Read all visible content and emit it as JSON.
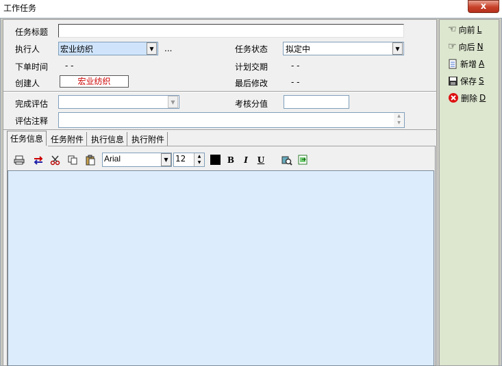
{
  "window": {
    "title": "工作任务",
    "close_glyph": "x"
  },
  "form": {
    "task_title": {
      "label": "任务标题",
      "value": ""
    },
    "executor": {
      "label": "执行人",
      "value": "宏业纺织",
      "more": "..."
    },
    "task_status": {
      "label": "任务状态",
      "value": "拟定中"
    },
    "order_time": {
      "label": "下单时间",
      "value": "- -"
    },
    "planned_delivery": {
      "label": "计划交期",
      "value": "- -"
    },
    "creator": {
      "label": "创建人",
      "value": "宏业纺织"
    },
    "last_modified": {
      "label": "最后修改",
      "value": "- -"
    },
    "completion_eval": {
      "label": "完成评估",
      "value": ""
    },
    "assessment_score": {
      "label": "考核分值",
      "value": ""
    },
    "eval_notes": {
      "label": "评估注释",
      "value": ""
    }
  },
  "tabs": [
    {
      "label": "任务信息",
      "active": true
    },
    {
      "label": "任务附件",
      "active": false
    },
    {
      "label": "执行信息",
      "active": false
    },
    {
      "label": "执行附件",
      "active": false
    }
  ],
  "toolbar": {
    "font": "Arial",
    "size": "12",
    "bold": "B",
    "italic": "I",
    "underline": "U",
    "icons": [
      "printer-icon",
      "swap-icon",
      "cut-icon",
      "copy-icon",
      "paste-icon",
      "color-icon",
      "preview-icon",
      "export-icon"
    ]
  },
  "side": {
    "prev": {
      "label": "向前",
      "key": "L"
    },
    "next": {
      "label": "向后",
      "key": "N"
    },
    "add": {
      "label": "新增",
      "key": "A"
    },
    "save": {
      "label": "保存",
      "key": "S"
    },
    "delete": {
      "label": "删除",
      "key": "D"
    }
  },
  "colors": {
    "creator_text": "#cc0000",
    "executor_bg": "#cfe4fb",
    "editor_bg": "#dcecfc",
    "side_bg": "#dde6cf"
  }
}
